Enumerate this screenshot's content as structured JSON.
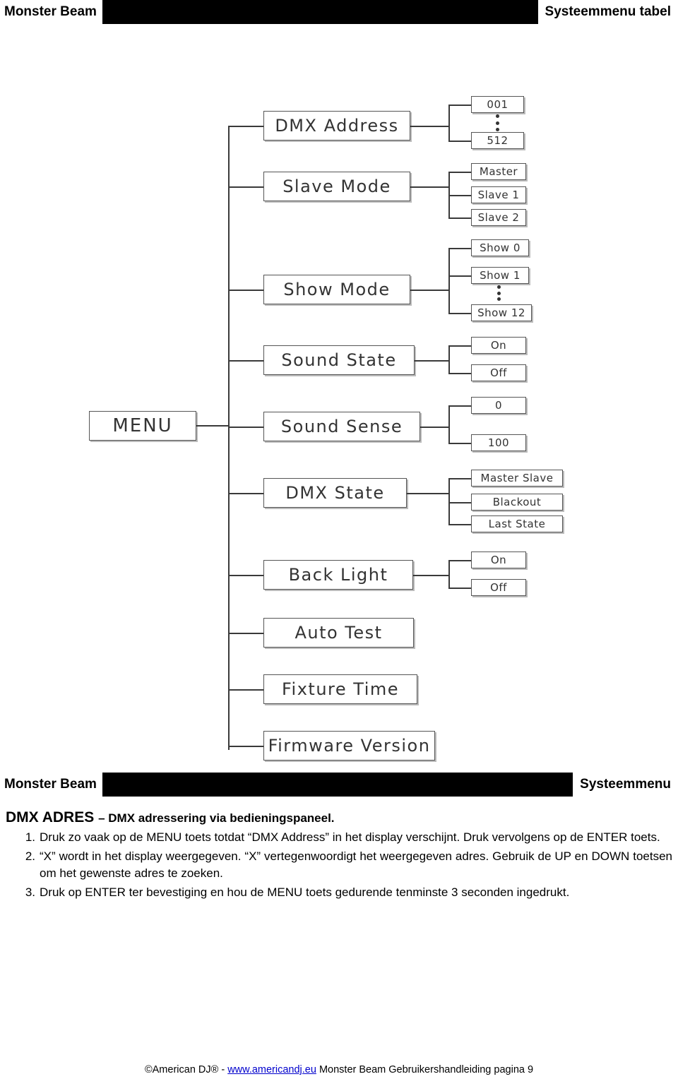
{
  "header_top": {
    "left_title": "Monster Beam",
    "right_title": "Systeemmenu tabel"
  },
  "header_bottom": {
    "left_title": "Monster Beam",
    "right_title": "Systeemmenu"
  },
  "diagram": {
    "root": "MENU",
    "items": [
      {
        "label": "DMX Address",
        "options": [
          "001",
          "512"
        ],
        "has_ellipsis": true
      },
      {
        "label": "Slave Mode",
        "options": [
          "Master",
          "Slave 1",
          "Slave 2"
        ],
        "has_ellipsis": false
      },
      {
        "label": "Show Mode",
        "options": [
          "Show 0",
          "Show 1",
          "Show 12"
        ],
        "has_ellipsis": true
      },
      {
        "label": "Sound State",
        "options": [
          "On",
          "Off"
        ],
        "has_ellipsis": false
      },
      {
        "label": "Sound Sense",
        "options": [
          "0",
          "100"
        ],
        "has_ellipsis": false
      },
      {
        "label": "DMX State",
        "options": [
          "Master Slave",
          "Blackout",
          "Last State"
        ],
        "has_ellipsis": false
      },
      {
        "label": "Back Light",
        "options": [
          "On",
          "Off"
        ],
        "has_ellipsis": false
      },
      {
        "label": "Auto Test",
        "options": [],
        "has_ellipsis": false
      },
      {
        "label": "Fixture Time",
        "options": [],
        "has_ellipsis": false
      },
      {
        "label": "Firmware Version",
        "options": [],
        "has_ellipsis": false
      }
    ]
  },
  "section": {
    "title_main": "DMX ADRES",
    "title_sub": "– DMX adressering via bedieningspaneel.",
    "steps": [
      {
        "num": "1.",
        "text": "Druk zo vaak op de MENU toets totdat “DMX Address” in het display verschijnt. Druk vervolgens op de ENTER toets."
      },
      {
        "num": "2.",
        "text": "“X” wordt in het display weergegeven. “X” vertegenwoordigt het weergegeven adres. Gebruik de UP en DOWN toetsen om het gewenste adres te zoeken."
      },
      {
        "num": "3.",
        "text": "Druk op ENTER ter bevestiging en hou  de MENU toets gedurende tenminste 3 seconden ingedrukt."
      }
    ]
  },
  "footer": {
    "prefix": "©American DJ® - ",
    "link": "www.americandj.eu",
    "suffix": " Monster Beam Gebruikershandleiding pagina 9"
  }
}
